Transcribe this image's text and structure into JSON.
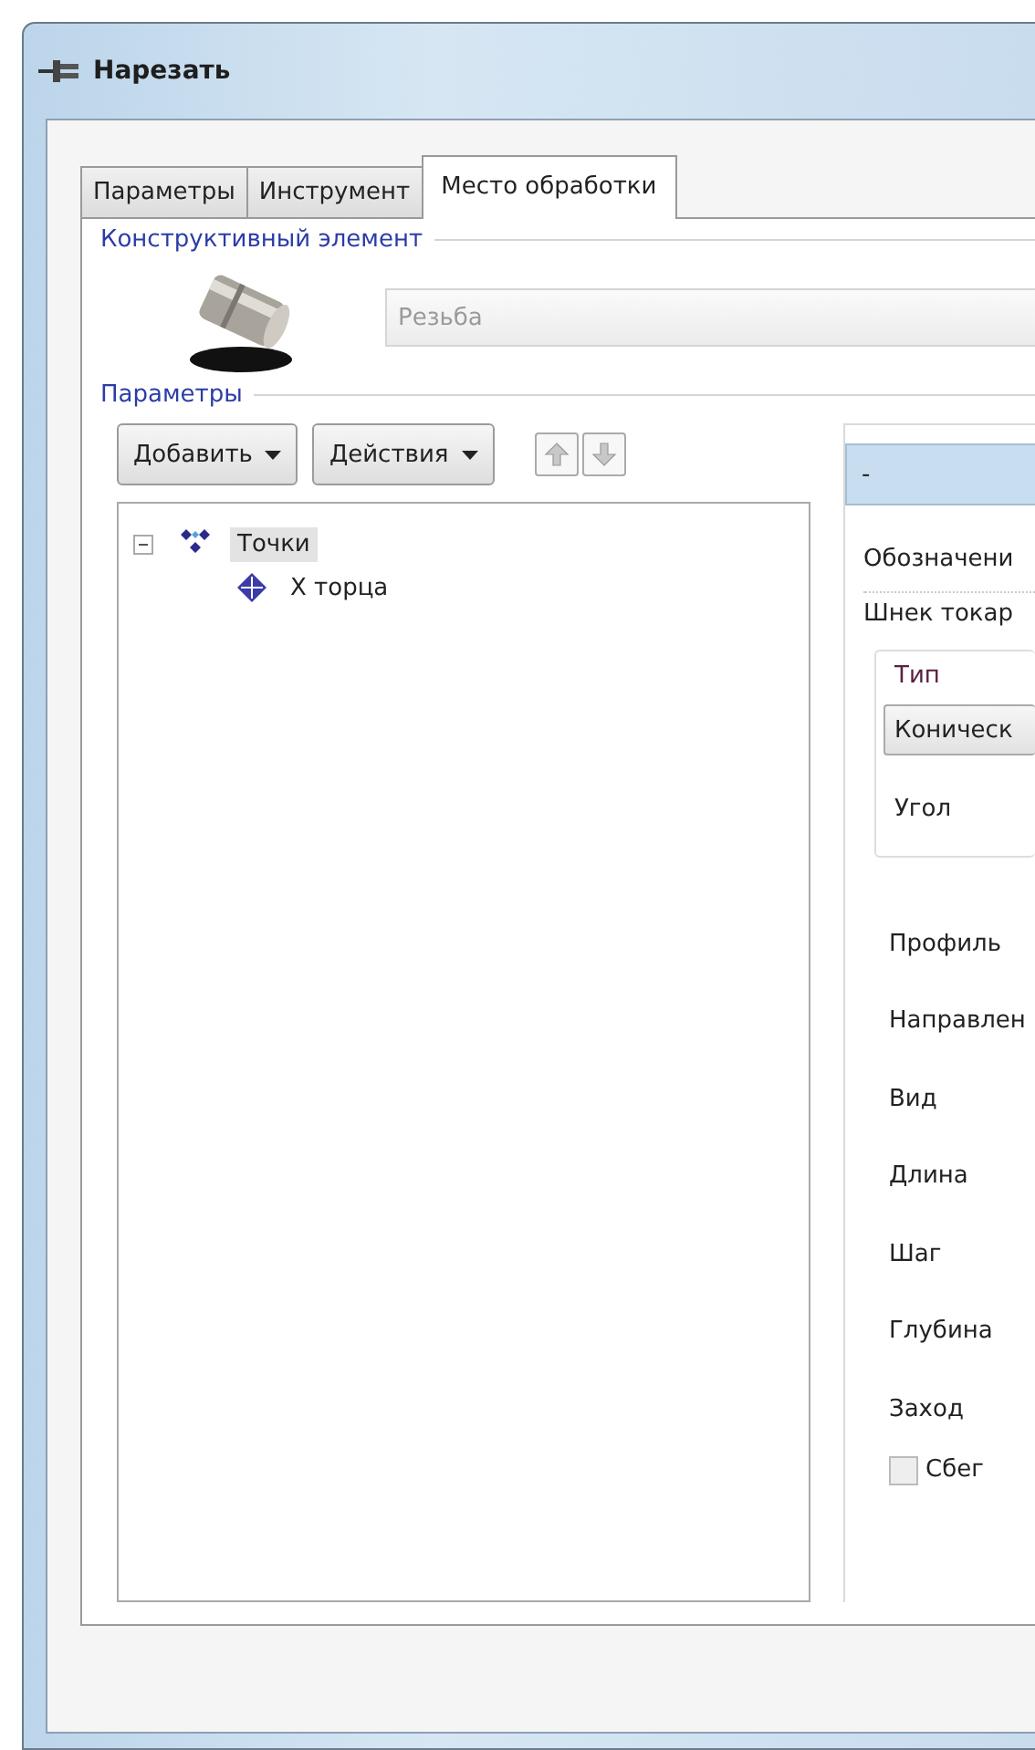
{
  "window": {
    "title": "Нарезать"
  },
  "tabs": [
    {
      "label": "Параметры",
      "selected": false
    },
    {
      "label": "Инструмент",
      "selected": false
    },
    {
      "label": "Место обработки",
      "selected": true
    }
  ],
  "feature_group": {
    "title": "Конструктивный элемент",
    "field_value": "Резьба"
  },
  "params_group": {
    "title": "Параметры"
  },
  "toolbar": {
    "dropdowns": [
      "Добавить",
      "Действия"
    ],
    "arrow_buttons": [
      {
        "kind": "up",
        "disabled": true
      },
      {
        "kind": "down",
        "disabled": true
      }
    ]
  },
  "tree": [
    {
      "label": "Точки",
      "kind": "points",
      "expanded": true,
      "selected": true,
      "children": [
        {
          "label": "X торца",
          "kind": "point",
          "selected": false
        }
      ]
    }
  ],
  "right_panel": {
    "header": "-",
    "designation_label": "Обозначени",
    "designation_value": "Шнек токар",
    "type_group": {
      "title": "Тип",
      "combo_value": "Коническ",
      "angle_label": "Угол"
    },
    "rows": [
      {
        "kind": "label",
        "text": "Профиль"
      },
      {
        "kind": "label",
        "text": "Направлен"
      },
      {
        "kind": "label",
        "text": "Вид"
      },
      {
        "kind": "label",
        "text": "Длина"
      },
      {
        "kind": "label",
        "text": "Шаг"
      },
      {
        "kind": "label",
        "text": "Глубина"
      },
      {
        "kind": "label",
        "text": "Заход"
      },
      {
        "kind": "checkbox",
        "text": "Сбег",
        "checked": false
      }
    ]
  }
}
